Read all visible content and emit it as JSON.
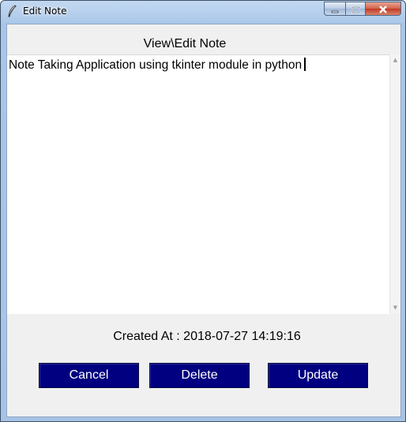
{
  "window": {
    "title": "Edit Note",
    "app_icon": "feather-icon",
    "caption_buttons": [
      "minimize-icon",
      "maximize-icon",
      "close-icon"
    ]
  },
  "main": {
    "heading": "View\\Edit Note",
    "note_text": "Note Taking Application using tkinter module in python",
    "created_at": "Created At : 2018-07-27 14:19:16"
  },
  "buttons": {
    "cancel": "Cancel",
    "delete": "Delete",
    "update": "Update"
  },
  "colors": {
    "button_bg": "#000080",
    "button_fg": "#ffffff",
    "client_bg": "#f0f0f0"
  }
}
